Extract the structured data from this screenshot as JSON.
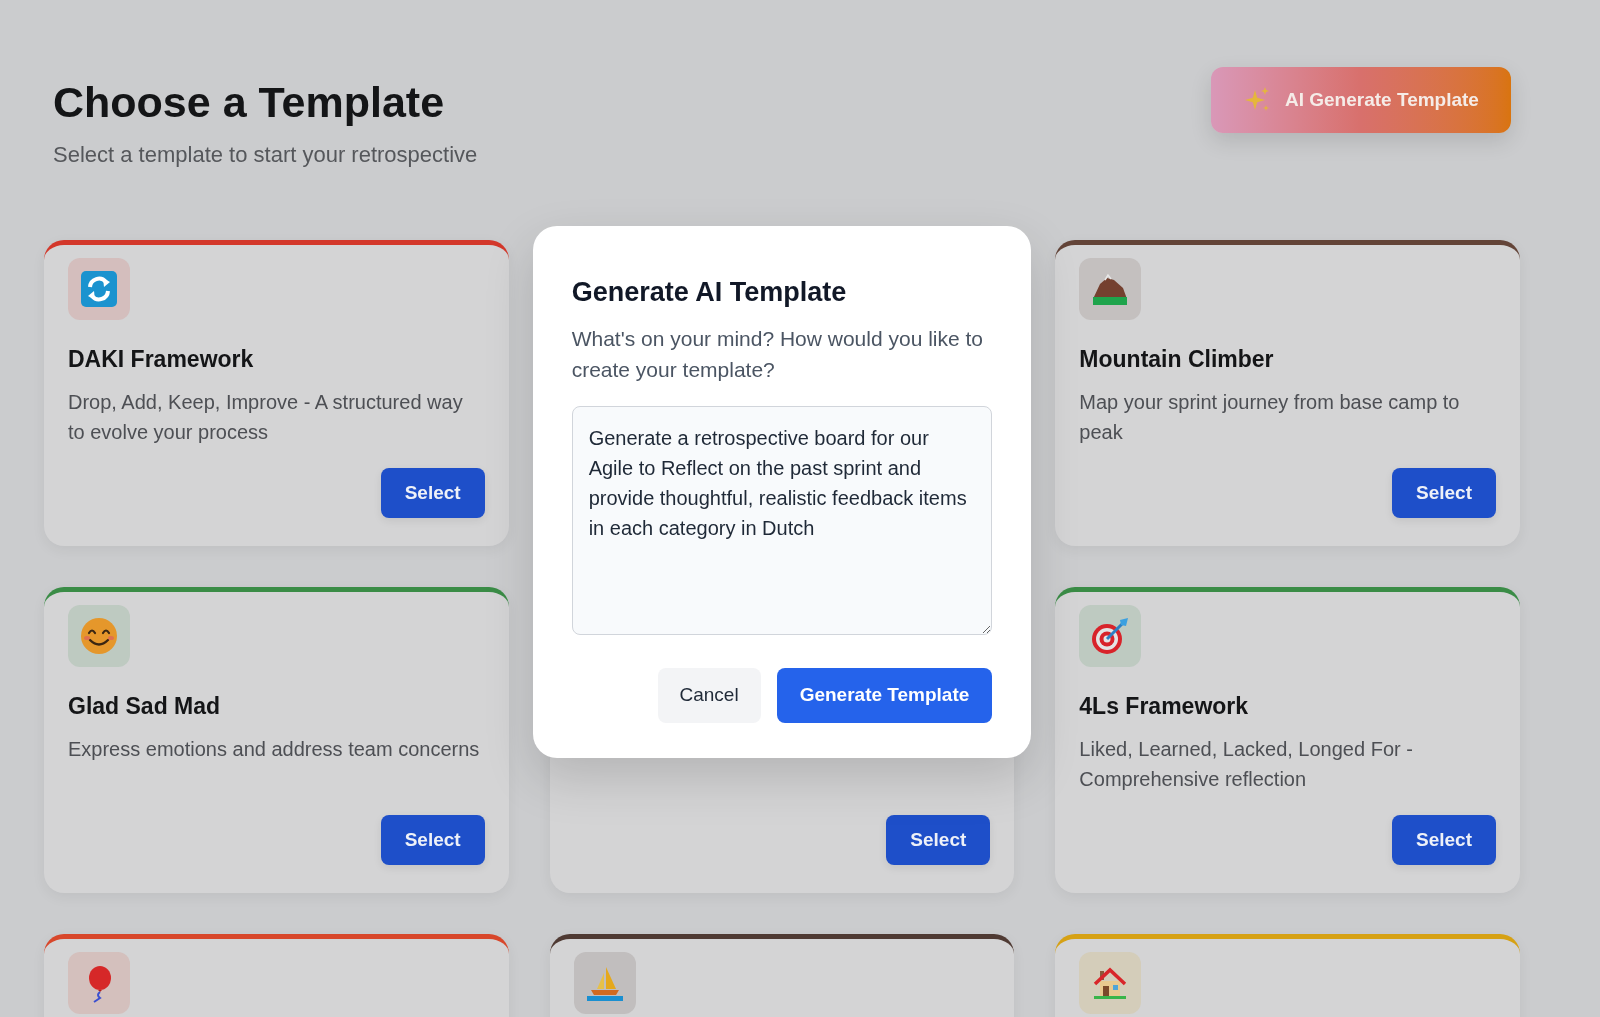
{
  "header": {
    "title": "Choose a Template",
    "subtitle": "Select a template to start your retrospective",
    "ai_button": "AI Generate Template"
  },
  "templates": [
    {
      "title": "DAKI Framework",
      "description": "Drop, Add, Keep, Improve - A structured way to evolve your process",
      "button": "Select",
      "color": "#d3382b"
    },
    {
      "title": "Mountain Climber",
      "description": "Map your sprint journey from base camp to peak",
      "button": "Select",
      "color": "#634438"
    },
    {
      "title": "Glad Sad Mad",
      "description": "Express emotions and address team concerns",
      "button": "Select",
      "color": "#3a8c46"
    },
    {
      "button": "Select"
    },
    {
      "title": "4Ls Framework",
      "description": "Liked, Learned, Lacked, Longed For - Comprehensive reflection",
      "button": "Select",
      "color": "#3a8c46"
    },
    {
      "color": "#d8472b"
    },
    {
      "color": "#4f3a33"
    },
    {
      "color": "#d6a114"
    }
  ],
  "modal": {
    "title": "Generate AI Template",
    "description": "What's on your mind? How would you like to create your template?",
    "prompt_field": {
      "value": "Generate a retrospective board for our Agile to Reflect on the past sprint and provide thoughtful, realistic feedback items in each category in Dutch"
    },
    "buttons": [
      {
        "label": "Cancel",
        "kind": "secondary"
      },
      {
        "label": "Generate Template",
        "kind": "primary"
      }
    ]
  }
}
